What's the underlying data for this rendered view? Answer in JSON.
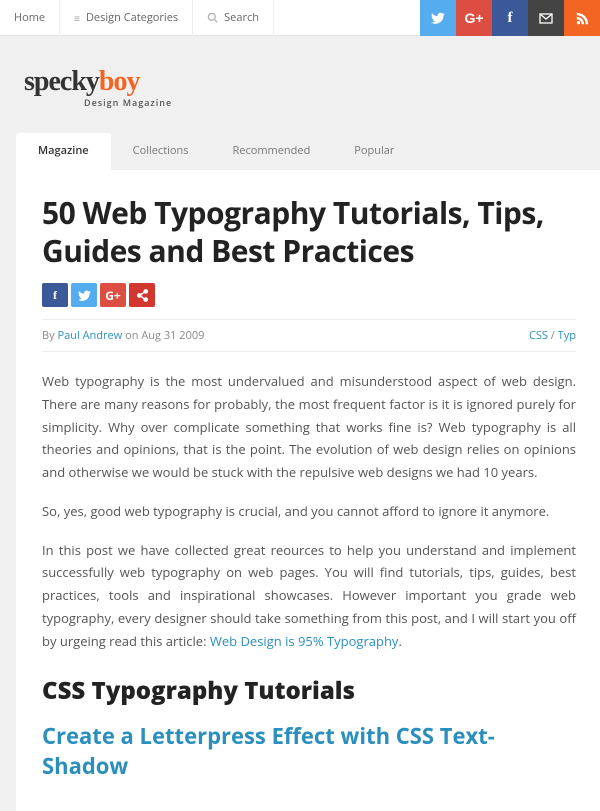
{
  "topnav": {
    "home": "Home",
    "categories": "Design Categories",
    "search": "Search"
  },
  "social_top": {
    "twitter": "twitter-icon",
    "gplus": "gplus-icon",
    "facebook": "facebook-icon",
    "mail": "mail-icon",
    "rss": "rss-icon"
  },
  "logo": {
    "part1": "specky",
    "part2": "boy",
    "tagline": "Design Magazine"
  },
  "tabs": [
    {
      "label": "Magazine",
      "active": true
    },
    {
      "label": "Collections",
      "active": false
    },
    {
      "label": "Recommended",
      "active": false
    },
    {
      "label": "Popular",
      "active": false
    }
  ],
  "article": {
    "title": "50 Web Typography Tutorials, Tips, Guides and Best Practices",
    "meta": {
      "by": "By ",
      "author": "Paul Andrew",
      "on": " on Aug 31 2009",
      "cat1": "CSS",
      "sep": " / ",
      "cat2": "Typ"
    },
    "p1": "Web typography is the most undervalued and misunderstood aspect of web design. There are many reasons for probably, the most frequent factor is it is ignored purely for simplicity. Why over complicate something that works fine is? Web typography is all theories and opinions, that is the point. The evolution of web design relies on opinions and otherwise we would be stuck with the repulsive web designs we had 10 years.",
    "p2": "So, yes, good web typography is crucial, and you cannot afford to ignore it anymore.",
    "p3a": "In this post we have collected great reources to help you understand and implement successfully web typography on web pages. You will find tutorials, tips, guides, best practices, tools and inspirational showcases. However important you grade web typography, every designer should take something from this post, and I will start you off by urgeing read this article: ",
    "p3link": "Web Design is 95% Typography",
    "p3b": ".",
    "h2": "CSS Typography Tutorials",
    "h3": "Create a Letterpress Effect with CSS Text-Shadow"
  }
}
